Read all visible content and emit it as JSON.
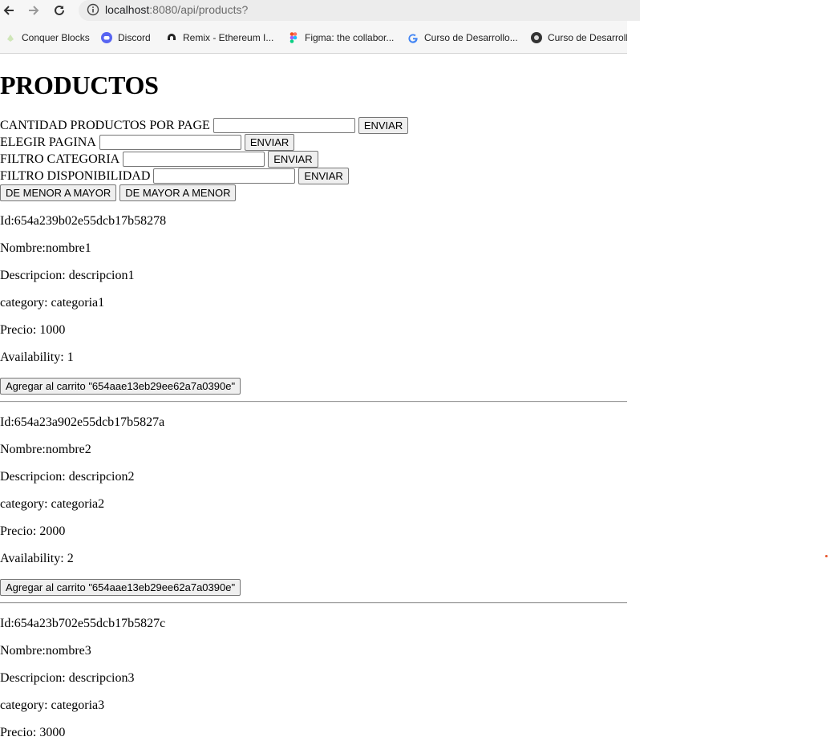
{
  "browser": {
    "url_host": "localhost",
    "url_path": ":8080/api/products?",
    "bookmarks": [
      {
        "label": "Conquer Blocks",
        "icon": "conquer-blocks-icon"
      },
      {
        "label": "Discord",
        "icon": "discord-icon"
      },
      {
        "label": "Remix - Ethereum I...",
        "icon": "remix-icon"
      },
      {
        "label": "Figma: the collabor...",
        "icon": "figma-icon"
      },
      {
        "label": "Curso de Desarrollo...",
        "icon": "google-icon"
      },
      {
        "label": "Curso de Desarroll",
        "icon": "course-icon"
      }
    ]
  },
  "page": {
    "title": "PRODUCTOS",
    "forms": [
      {
        "label": "CANTIDAD PRODUCTOS POR PAGE",
        "value": "",
        "button": "ENVIAR"
      },
      {
        "label": "ELEGIR PAGINA",
        "value": "",
        "button": "ENVIAR"
      },
      {
        "label": "FILTRO CATEGORIA",
        "value": "",
        "button": "ENVIAR"
      },
      {
        "label": "FILTRO DISPONIBILIDAD",
        "value": "",
        "button": "ENVIAR"
      }
    ],
    "sort": {
      "asc_label": "DE MENOR A MAYOR",
      "desc_label": "DE MAYOR A MENOR"
    },
    "products": [
      {
        "id": "Id:654a239b02e55dcb17b58278",
        "nombre": "Nombre:nombre1",
        "descripcion": "Descripcion: descripcion1",
        "category": "category: categoria1",
        "precio": "Precio: 1000",
        "availability": "Availability: 1",
        "cart_button": "Agregar al carrito \"654aae13eb29ee62a7a0390e\""
      },
      {
        "id": "Id:654a23a902e55dcb17b5827a",
        "nombre": "Nombre:nombre2",
        "descripcion": "Descripcion: descripcion2",
        "category": "category: categoria2",
        "precio": "Precio: 2000",
        "availability": "Availability: 2",
        "cart_button": "Agregar al carrito \"654aae13eb29ee62a7a0390e\""
      },
      {
        "id": "Id:654a23b702e55dcb17b5827c",
        "nombre": "Nombre:nombre3",
        "descripcion": "Descripcion: descripcion3",
        "category": "category: categoria3",
        "precio": "Precio: 3000"
      }
    ]
  }
}
